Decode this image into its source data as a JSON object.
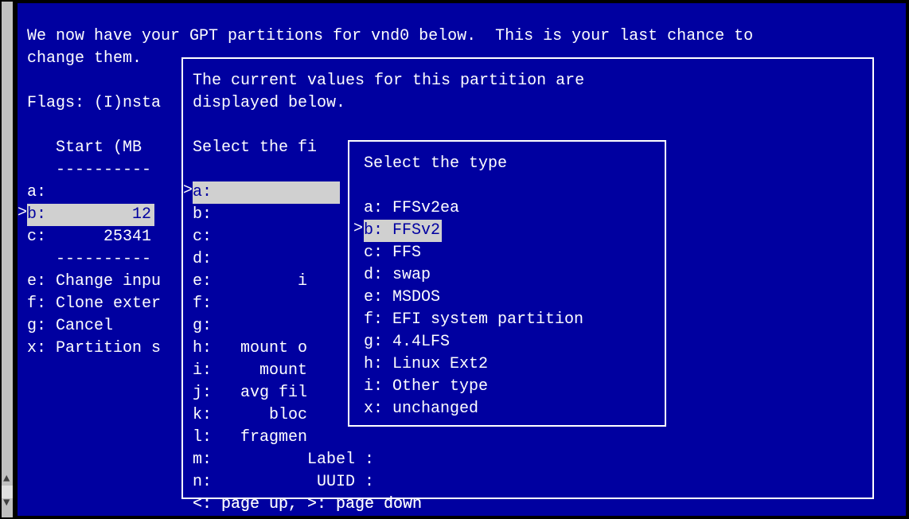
{
  "bg": {
    "line1": "We now have your GPT partitions for vnd0 below.  This is your last chance to",
    "line2": "change them.",
    "flags": "Flags: (I)nsta",
    "startHeader": "   Start (MB",
    "dashes": "   ----------",
    "a": "a:",
    "b": "b:         12",
    "c": "c:      25341",
    "dashes2": "   ----------",
    "e": "e: Change inpu",
    "f": "f: Clone exter",
    "g": "g: Cancel",
    "x": "x: Partition s"
  },
  "box1": {
    "line1": "The current values for this partition are",
    "line2": "displayed below.",
    "line3": "Select the fi",
    "a": "a:",
    "b": "b:",
    "c": "c:",
    "d": "d:",
    "e": "e:         i",
    "f": "f:",
    "g": "g:",
    "h": "h:   mount o",
    "i": "i:     mount",
    "j": "j:   avg fil",
    "k": "k:      bloc",
    "l": "l:   fragmen",
    "m": "m:          Label :",
    "n": "n:           UUID :",
    "pager": "<: page up, >: page down"
  },
  "box2": {
    "title": "Select the type",
    "items": {
      "a": "a: FFSv2ea",
      "b": "b: FFSv2",
      "c": "c: FFS",
      "d": "d: swap",
      "e": "e: MSDOS",
      "f": "f: EFI system partition",
      "g": "g: 4.4LFS",
      "h": "h: Linux Ext2",
      "i": "i: Other type",
      "x": "x: unchanged"
    }
  }
}
